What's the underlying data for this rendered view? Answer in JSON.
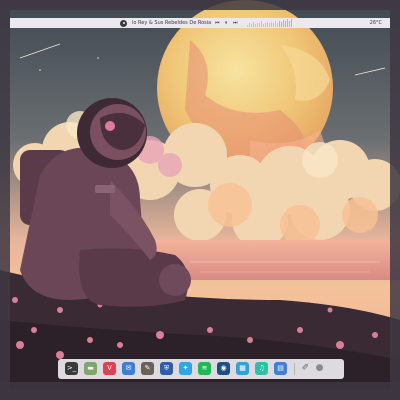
{
  "top_panel": {
    "now_playing": "lo Rey & Sus Rebeldes De Rosia",
    "controls": [
      "⏮",
      "⏸",
      "⏭"
    ],
    "temperature": "26°C",
    "visualizer_levels": [
      0.3,
      0.5,
      0.4,
      0.6,
      0.35,
      0.55,
      0.45,
      0.7,
      0.4,
      0.5,
      0.6,
      0.45,
      0.65,
      0.5,
      0.75,
      0.55,
      0.8,
      0.6,
      0.85,
      0.7,
      0.95,
      0.75,
      1.0
    ]
  },
  "dock": {
    "items": [
      {
        "name": "terminal-icon",
        "glyph": ">_",
        "color": "#3a3a3a"
      },
      {
        "name": "files-icon",
        "glyph": "▬",
        "color": "#7da86a"
      },
      {
        "name": "vivaldi-icon",
        "glyph": "V",
        "color": "#e0414f"
      },
      {
        "name": "mail-icon",
        "glyph": "✉",
        "color": "#3b7dd8"
      },
      {
        "name": "gimp-icon",
        "glyph": "✎",
        "color": "#6b6157"
      },
      {
        "name": "security-icon",
        "glyph": "⛨",
        "color": "#2f5fa8"
      },
      {
        "name": "bird-icon",
        "glyph": "✦",
        "color": "#2da6e8"
      },
      {
        "name": "spotify-icon",
        "glyph": "≋",
        "color": "#1db954"
      },
      {
        "name": "steam-icon",
        "glyph": "◉",
        "color": "#1b4f8a"
      },
      {
        "name": "app-grid-icon",
        "glyph": "▦",
        "color": "#35a0d8"
      },
      {
        "name": "music-icon",
        "glyph": "♫",
        "color": "#2cc1a4"
      },
      {
        "name": "document-icon",
        "glyph": "▤",
        "color": "#3f7fd6"
      },
      {
        "name": "color-picker-icon",
        "glyph": "✐",
        "color": "#6a6470"
      },
      {
        "name": "trash-icon",
        "glyph": "●",
        "color": "#8c888f"
      }
    ]
  },
  "colors": {
    "panel_bg": "#ece9ee",
    "sky_top": "#4c5560",
    "moon": "#f2d27a",
    "cloud_pink": "#f0a89a",
    "ground": "#3a2a34"
  }
}
